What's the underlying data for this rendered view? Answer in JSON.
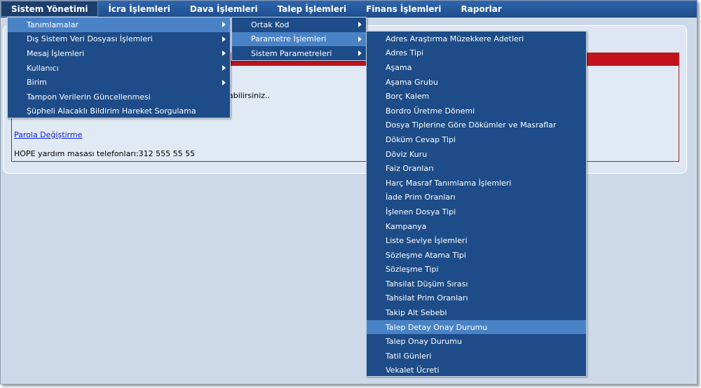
{
  "menubar": {
    "items": [
      "Sistem Yönetimi",
      "İcra İşlemleri",
      "Dava İşlemleri",
      "Talep İşlemleri",
      "Finans İşlemleri",
      "Raporlar"
    ]
  },
  "content": {
    "partial_text": "nabilirsiniz..",
    "password_link": "Parola Değiştirme",
    "helpdesk_text": "HOPE yardım masası telefonları:312 555 55 55"
  },
  "menu1": {
    "items": [
      "Tanımlamalar",
      "Dış Sistem Veri Dosyası İşlemleri",
      "Mesaj İşlemleri",
      "Kullanıcı",
      "Birim",
      "Tampon Verilerin Güncellenmesi",
      "Şüpheli Alacaklı Bildirim Hareket Sorgulama"
    ]
  },
  "menu2": {
    "items": [
      "Ortak Kod",
      "Parametre İşlemleri",
      "Sistem Parametreleri"
    ]
  },
  "menu3": {
    "items": [
      "Adres Araştırma Müzekkere Adetleri",
      "Adres Tipi",
      "Aşama",
      "Aşama Grubu",
      "Borç Kalem",
      "Bordro Üretme Dönemi",
      "Dosya Tiplerine Göre Dökümler ve Masraflar",
      "Döküm Cevap Tipi",
      "Döviz Kuru",
      "Faiz Oranları",
      "Harç Masraf Tanımlama İşlemleri",
      "İade Prim Oranları",
      "İşlenen Dosya Tipi",
      "Kampanya",
      "Liste Seviye İşlemleri",
      "Sözleşme Atama Tipi",
      "Sözleşme Tipi",
      "Tahsilat Düşüm Sırası",
      "Tahsilat Prim Oranları",
      "Takip Alt Sebebi",
      "Talep Detay Onay Durumu",
      "Talep Onay Durumu",
      "Tatil Günleri",
      "Vekalet Ücreti"
    ]
  },
  "colors": {
    "menu_bg": "#1d4c88",
    "menu_highlight": "#4a82c6",
    "menubar": "#2a5ea3",
    "alert_red": "#c2121b",
    "page_bg": "#cdd9e8"
  }
}
